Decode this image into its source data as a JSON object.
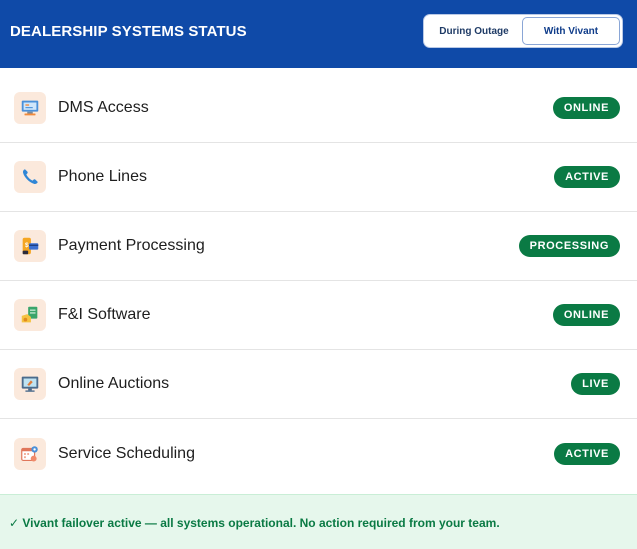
{
  "header": {
    "title": "DEALERSHIP SYSTEMS STATUS",
    "toggle": {
      "option_outage": "During Outage",
      "option_vivant": "With Vivant",
      "selected": "With Vivant"
    }
  },
  "systems": [
    {
      "label": "DMS Access",
      "status": "ONLINE",
      "icon": "computer-terminal-icon"
    },
    {
      "label": "Phone Lines",
      "status": "ACTIVE",
      "icon": "phone-icon"
    },
    {
      "label": "Payment Processing",
      "status": "PROCESSING",
      "icon": "payment-card-icon"
    },
    {
      "label": "F&I Software",
      "status": "ONLINE",
      "icon": "finance-software-icon"
    },
    {
      "label": "Online Auctions",
      "status": "LIVE",
      "icon": "auction-monitor-icon"
    },
    {
      "label": "Service Scheduling",
      "status": "ACTIVE",
      "icon": "calendar-gear-icon"
    }
  ],
  "footer": {
    "message": "✓ Vivant failover active — all systems operational. No action required from your team."
  },
  "colors": {
    "header_bg": "#0f4aa8",
    "badge_bg": "#0a7a44",
    "footer_bg": "#e6f7ec",
    "icon_bg": "#fbe9dc"
  }
}
